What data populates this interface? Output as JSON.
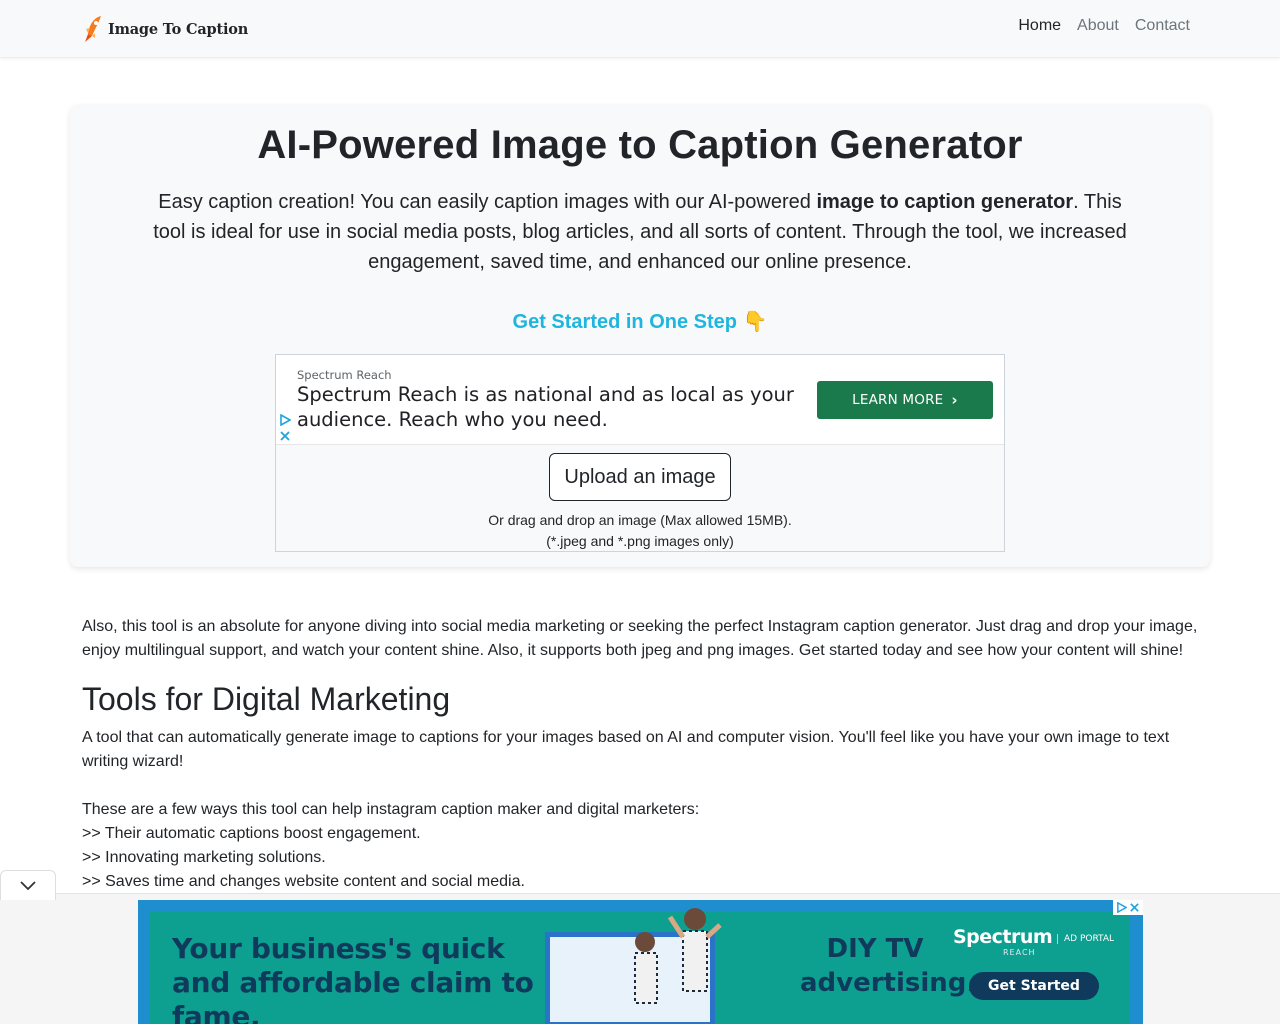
{
  "nav": {
    "brand": "Image To Caption",
    "links": [
      "Home",
      "About",
      "Contact"
    ]
  },
  "hero": {
    "title": "AI-Powered Image to Caption Generator",
    "desc_before": "Easy caption creation! You can easily caption images with our AI-powered ",
    "desc_bold": "image to caption generator",
    "desc_after": ". This tool is ideal for use in social media posts, blog articles, and all sorts of content. Through the tool, we increased engagement, saved time, and enhanced our online presence.",
    "get_started": "Get Started in One Step 👇"
  },
  "inline_ad": {
    "sponsor": "Spectrum Reach",
    "headline": "Spectrum Reach is as national and as local as your audience. Reach who you need.",
    "cta": "LEARN MORE"
  },
  "upload": {
    "button": "Upload an image",
    "hint_line1": "Or drag and drop an image (Max allowed 15MB).",
    "hint_line2": "(*.jpeg and *.png images only)"
  },
  "content": {
    "intro": "Also, this tool is an absolute for anyone diving into social media marketing or seeking the perfect Instagram caption generator. Just drag and drop your image, enjoy multilingual support, and watch your content shine. Also, it supports both jpeg and png images. Get started today and see how your content will shine!",
    "heading": "Tools for Digital Marketing",
    "para": "A tool that can automatically generate image to captions for your images based on AI and computer vision. You'll feel like you have your own image to text writing wizard!",
    "ways_title": "These are a few ways this tool can help instagram caption maker and digital marketers:",
    "ways": [
      ">> Their automatic captions boost engagement.",
      ">> Innovating marketing solutions.",
      ">> Saves time and changes website content and social media."
    ]
  },
  "banner_ad": {
    "left_text": "Your business's quick and affordable claim to fame.",
    "mid_text": "DIY TV advertising.",
    "brand": "Spectrum",
    "brand_sub": "REACH",
    "portal": "AD PORTAL",
    "cta": "Get Started"
  },
  "colors": {
    "accent": "#1eb6de",
    "ad_cta": "#1b7a4c",
    "banner_bg": "#0d9f8f",
    "banner_text": "#103a5c"
  }
}
